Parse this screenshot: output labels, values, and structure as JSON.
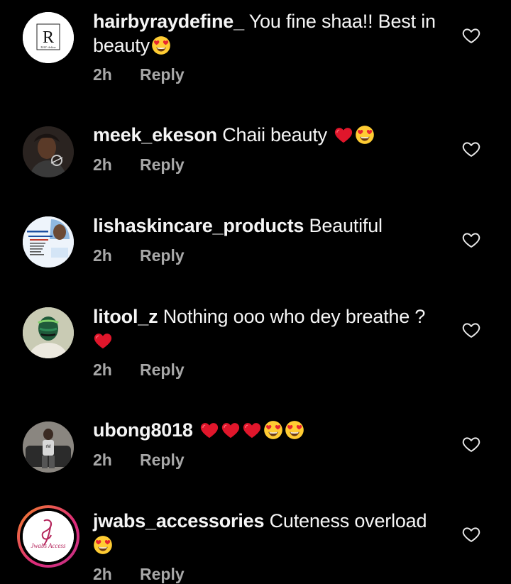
{
  "comments": [
    {
      "username": "hairbyraydefine_",
      "text": " You fine shaa!! Best in beauty",
      "emojis": [
        "heart-eyes-face"
      ],
      "time": "2h",
      "reply_label": "Reply",
      "avatar": "ray-define-logo",
      "avatar_text": "R",
      "avatar_caption": "RAY define"
    },
    {
      "username": "meek_ekeson",
      "text": " Chaii beauty ",
      "emojis": [
        "red-heart",
        "heart-eyes-face"
      ],
      "time": "2h",
      "reply_label": "Reply",
      "avatar": "user-photo"
    },
    {
      "username": "lishaskincare_products",
      "text": " Beautiful",
      "emojis": [],
      "time": "2h",
      "reply_label": "Reply",
      "avatar": "product-flyer"
    },
    {
      "username": "litool_z",
      "text": " Nothing ooo who dey breathe ?",
      "emojis": [
        "red-heart"
      ],
      "time": "2h",
      "reply_label": "Reply",
      "avatar": "user-photo"
    },
    {
      "username": "ubong8018",
      "text": " ",
      "emojis": [
        "red-heart",
        "red-heart",
        "red-heart",
        "heart-eyes-face",
        "heart-eyes-face"
      ],
      "time": "2h",
      "reply_label": "Reply",
      "avatar": "user-photo"
    },
    {
      "username": "jwabs_accessories",
      "text": " Cuteness overload",
      "emojis": [
        "heart-eyes-face"
      ],
      "time": "2h",
      "reply_label": "Reply",
      "avatar": "jwabs-logo",
      "avatar_text": "Jwabs Access"
    }
  ],
  "colors": {
    "background": "#000000",
    "text": "#f5f5f5",
    "meta": "#a8a8a8",
    "heart": "#e0162b",
    "story_ring_start": "#f58529",
    "story_ring_end": "#dd2a7b"
  }
}
